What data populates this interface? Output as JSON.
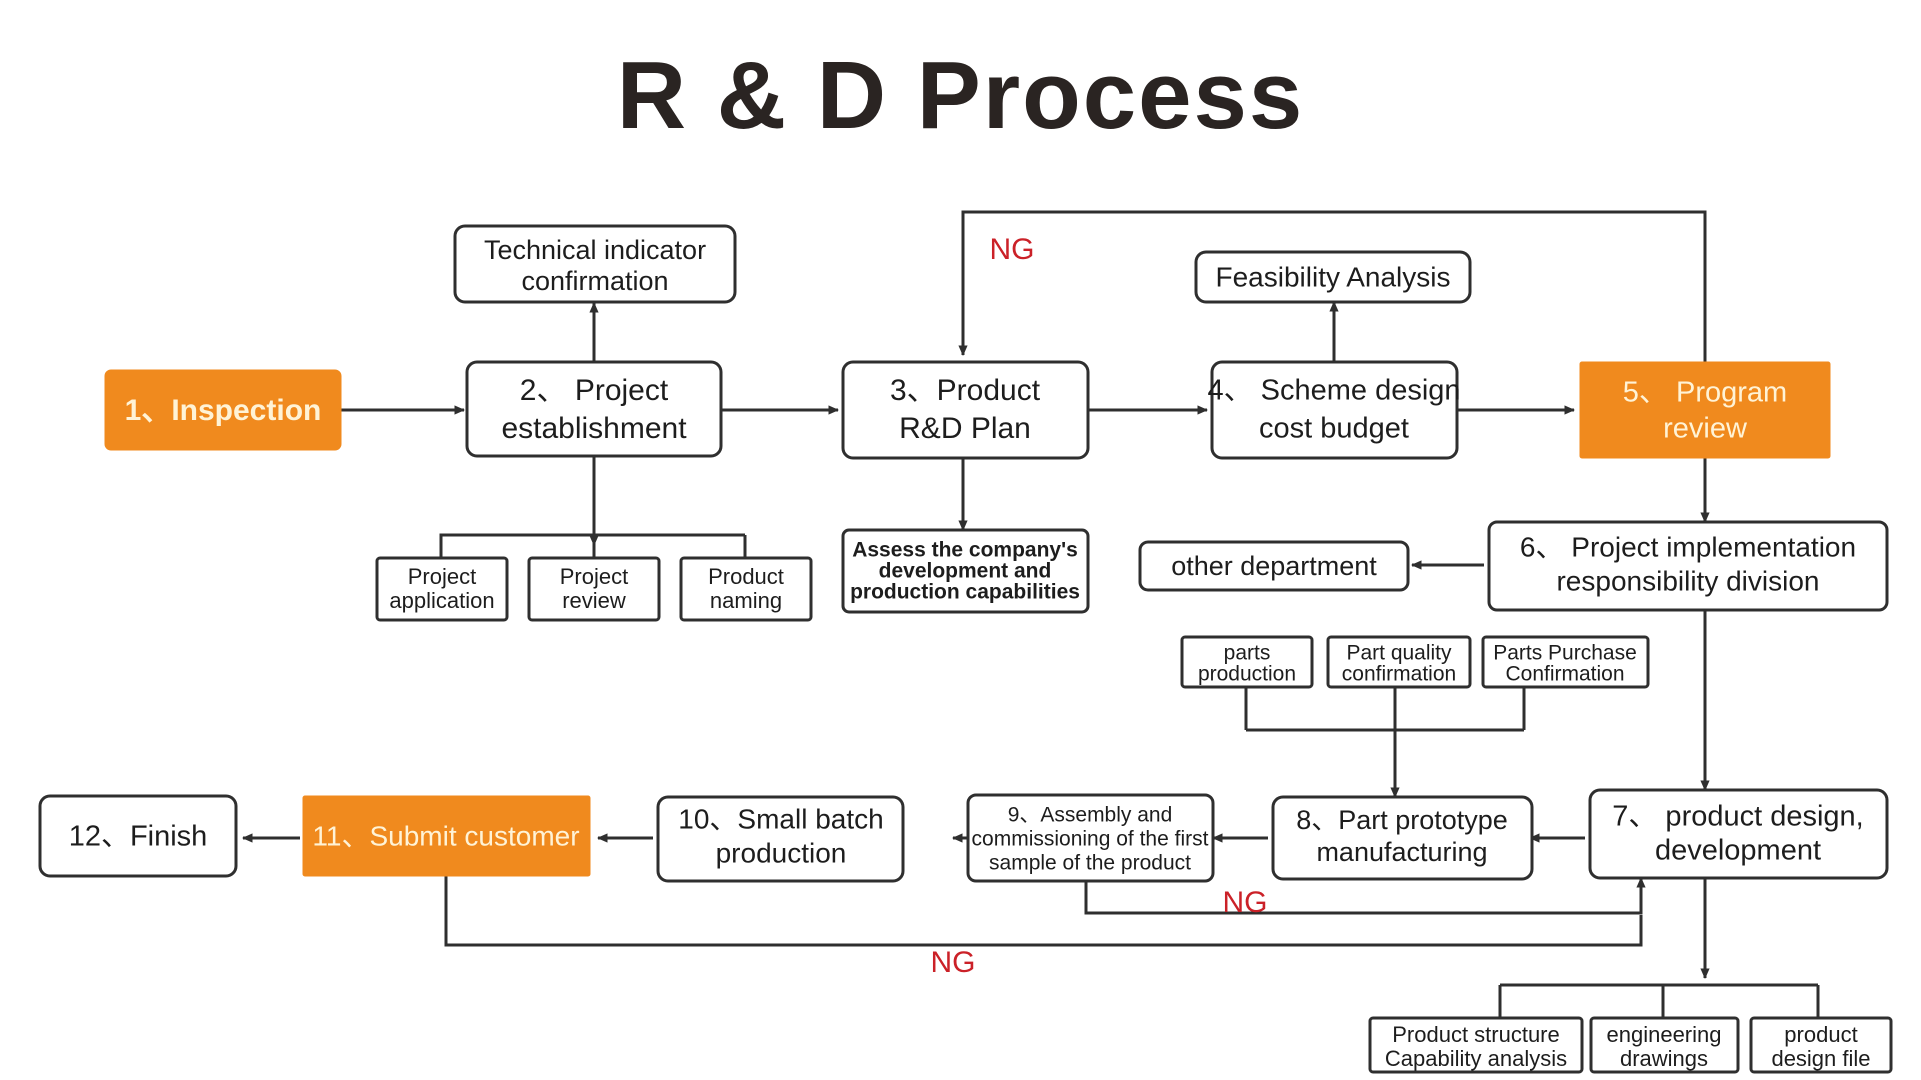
{
  "page": {
    "title": "R & D Process",
    "background": "#ffffff",
    "accent_color": "#F08A1E",
    "accent_text_color": "#FFF3D6",
    "line_color": "#2f2f2f",
    "ng_color": "#CB2128",
    "title_color": "#2a2422"
  },
  "nodes": {
    "n1": {
      "label": "1、Inspection",
      "highlight": true
    },
    "n2": {
      "label": "2、 Project\nestablishment",
      "highlight": false
    },
    "n3": {
      "label": "3、Product\nR&D Plan",
      "highlight": false
    },
    "n4": {
      "label": "4、 Scheme design\ncost budget",
      "highlight": false
    },
    "n5": {
      "label": "5、 Program\nreview",
      "highlight": true
    },
    "n6": {
      "label": "6、 Project implementation\nresponsibility division",
      "highlight": false
    },
    "n7": {
      "label": "7、 product design,\ndevelopment",
      "highlight": false
    },
    "n8": {
      "label": "8、Part prototype\nmanufacturing",
      "highlight": false
    },
    "n9": {
      "label": "9、Assembly and\ncommissioning of the first\nsample of the product",
      "highlight": false
    },
    "n10": {
      "label": "10、Small batch\nproduction",
      "highlight": false
    },
    "n11": {
      "label": "11、Submit customer",
      "highlight": true
    },
    "n12": {
      "label": "12、Finish",
      "highlight": false
    },
    "tech": {
      "label": "Technical indicator\nconfirmation",
      "highlight": false
    },
    "feas": {
      "label": "Feasibility Analysis",
      "highlight": false
    },
    "other": {
      "label": "other department",
      "highlight": false
    },
    "assess": {
      "label": "Assess the company's\ndevelopment and\nproduction capabilities",
      "highlight": false
    },
    "pa": {
      "label": "Project\napplication",
      "highlight": false
    },
    "pr": {
      "label": "Project\nreview",
      "highlight": false
    },
    "pn": {
      "label": "Product\nnaming",
      "highlight": false
    },
    "pp": {
      "label": "parts\nproduction",
      "highlight": false
    },
    "pqc": {
      "label": "Part quality\nconfirmation",
      "highlight": false
    },
    "ppc": {
      "label": "Parts Purchase\nConfirmation",
      "highlight": false
    },
    "psc": {
      "label": "Product structure\nCapability analysis",
      "highlight": false
    },
    "ed": {
      "label": "engineering\ndrawings",
      "highlight": false
    },
    "pdf": {
      "label": "product\ndesign file",
      "highlight": false
    }
  },
  "ng_labels": [
    {
      "id": "ng-top",
      "text": "NG"
    },
    {
      "id": "ng-mid",
      "text": "NG"
    },
    {
      "id": "ng-bottom",
      "text": "NG"
    }
  ],
  "flow_sequence": [
    "1、Inspection",
    "2、 Project establishment",
    "3、Product R&D Plan",
    "4、 Scheme design cost budget",
    "5、 Program review",
    "6、 Project implementation responsibility division",
    "7、 product design, development",
    "8、Part prototype manufacturing",
    "9、Assembly and commissioning of the first sample of the product",
    "10、Small batch production",
    "11、Submit customer",
    "12、Finish"
  ]
}
